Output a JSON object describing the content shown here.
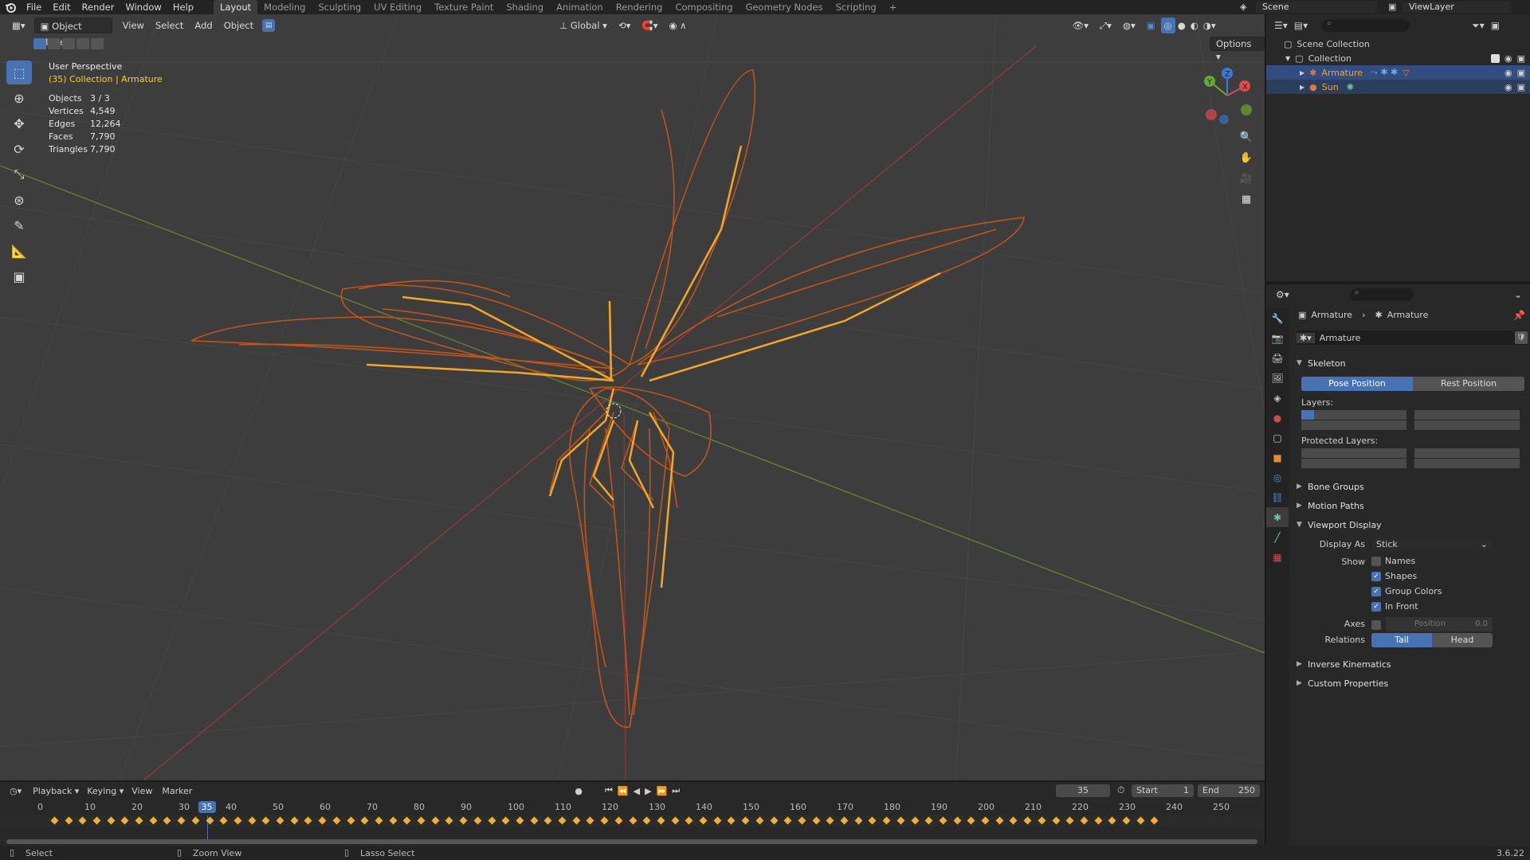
{
  "menu": {
    "file": "File",
    "edit": "Edit",
    "render": "Render",
    "window": "Window",
    "help": "Help"
  },
  "workspaces": [
    "Layout",
    "Modeling",
    "Sculpting",
    "UV Editing",
    "Texture Paint",
    "Shading",
    "Animation",
    "Rendering",
    "Compositing",
    "Geometry Nodes",
    "Scripting"
  ],
  "active_workspace": "Layout",
  "scene": {
    "label": "Scene",
    "view_layer": "ViewLayer"
  },
  "viewport": {
    "mode": "Object Mode",
    "view": "View",
    "select": "Select",
    "add": "Add",
    "object": "Object",
    "orientation": "Global",
    "options": "Options",
    "title": "User Perspective",
    "subtitle": "(35) Collection | Armature",
    "stats": [
      {
        "label": "Objects",
        "value": "3 / 3"
      },
      {
        "label": "Vertices",
        "value": "4,549"
      },
      {
        "label": "Edges",
        "value": "12,264"
      },
      {
        "label": "Faces",
        "value": "7,790"
      },
      {
        "label": "Triangles",
        "value": "7,790"
      }
    ],
    "gizmo": {
      "x": "X",
      "y": "Y",
      "z": "Z"
    }
  },
  "outliner": {
    "scene_collection": "Scene Collection",
    "collection": "Collection",
    "items": [
      {
        "name": "Armature"
      },
      {
        "name": "Sun"
      }
    ]
  },
  "properties": {
    "breadcrumb_obj": "Armature",
    "breadcrumb_data": "Armature",
    "datablock": "Armature",
    "skeleton": "Skeleton",
    "pose_position": "Pose Position",
    "rest_position": "Rest Position",
    "layers": "Layers:",
    "protected_layers": "Protected Layers:",
    "bone_groups": "Bone Groups",
    "motion_paths": "Motion Paths",
    "viewport_display": "Viewport Display",
    "display_as_label": "Display As",
    "display_as": "Stick",
    "show_label": "Show",
    "names": "Names",
    "shapes": "Shapes",
    "group_colors": "Group Colors",
    "in_front": "In Front",
    "axes_label": "Axes",
    "axes_position": "Position",
    "axes_value": "0.0",
    "relations_label": "Relations",
    "tail": "Tail",
    "head": "Head",
    "inverse_kinematics": "Inverse Kinematics",
    "custom_properties": "Custom Properties"
  },
  "timeline": {
    "playback": "Playback",
    "keying": "Keying",
    "view": "View",
    "marker": "Marker",
    "current_frame": "35",
    "start_label": "Start",
    "start": "1",
    "end_label": "End",
    "end": "250",
    "ticks": [
      "0",
      "10",
      "20",
      "30",
      "40",
      "50",
      "60",
      "70",
      "80",
      "90",
      "100",
      "110",
      "120",
      "130",
      "140",
      "150",
      "160",
      "170",
      "180",
      "190",
      "200",
      "210",
      "220",
      "230",
      "240",
      "250"
    ]
  },
  "status": {
    "select": "Select",
    "zoom": "Zoom View",
    "lasso": "Lasso Select",
    "version": "3.6.22"
  },
  "colors": {
    "accent": "#4772b3",
    "wire": "#c2541a",
    "bone": "#f5a623",
    "frame": "#4772b3"
  }
}
